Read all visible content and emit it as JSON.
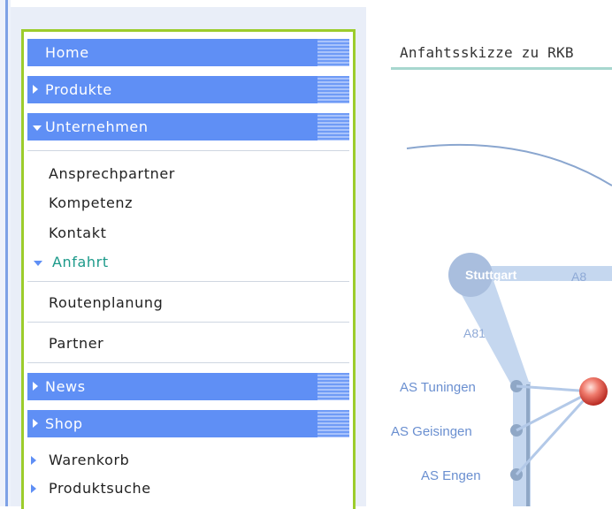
{
  "sidebar": {
    "items": [
      {
        "label": "Home"
      },
      {
        "label": "Produkte"
      },
      {
        "label": "Unternehmen"
      },
      {
        "label": "Ansprechpartner"
      },
      {
        "label": "Kompetenz"
      },
      {
        "label": "Kontakt"
      },
      {
        "label": "Anfahrt"
      },
      {
        "label": "Routenplanung"
      },
      {
        "label": "Partner"
      },
      {
        "label": "News"
      },
      {
        "label": "Shop"
      },
      {
        "label": "Warenkorb"
      },
      {
        "label": "Produktsuche"
      }
    ]
  },
  "content": {
    "title": "Anfahtsskizze zu RKB",
    "map": {
      "labels": {
        "stuttgart": "Stuttgart",
        "a8": "A8",
        "a81": "A81",
        "tuningen": "AS Tuningen",
        "geisingen": "AS Geisingen",
        "engen": "AS Engen"
      }
    }
  },
  "colors": {
    "menu_bar": "#5f8ff5",
    "menu_border": "#9ccc2c",
    "active_link": "#1c9a8a",
    "road": "#b7cdea"
  }
}
